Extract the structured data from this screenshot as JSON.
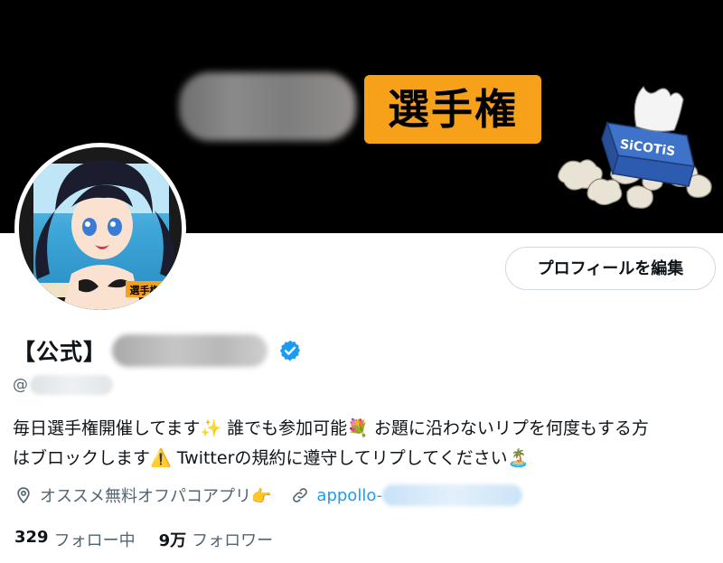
{
  "banner": {
    "title_text": "選手権",
    "tissue_box_text": "SiCOTiS",
    "avatar_badge_text": "選手権"
  },
  "profile": {
    "edit_button_label": "プロフィールを編集",
    "name_prefix": "【公式】",
    "handle_prefix": "@",
    "bio_line_1": "毎日選手権開催してます✨ 誰でも参加可能💐 お題に沿わないリプを何度もする方",
    "bio_line_2": "はブロックします⚠️ Twitterの規約に遵守してリプしてください🏝️",
    "location": "オススメ無料オフパコアプリ👉",
    "link_text": "appollo-"
  },
  "stats": {
    "following_count": "329",
    "following_label": "フォロー中",
    "followers_count": "9万",
    "followers_label": "フォロワー"
  },
  "icons": {
    "verified": "verified-badge-icon",
    "location": "location-pin-icon",
    "link": "link-icon"
  },
  "colors": {
    "accent": "#1d9bf0",
    "verified": "#1d9bf0",
    "banner_tag": "#f7a11a",
    "muted_text": "#536471"
  }
}
